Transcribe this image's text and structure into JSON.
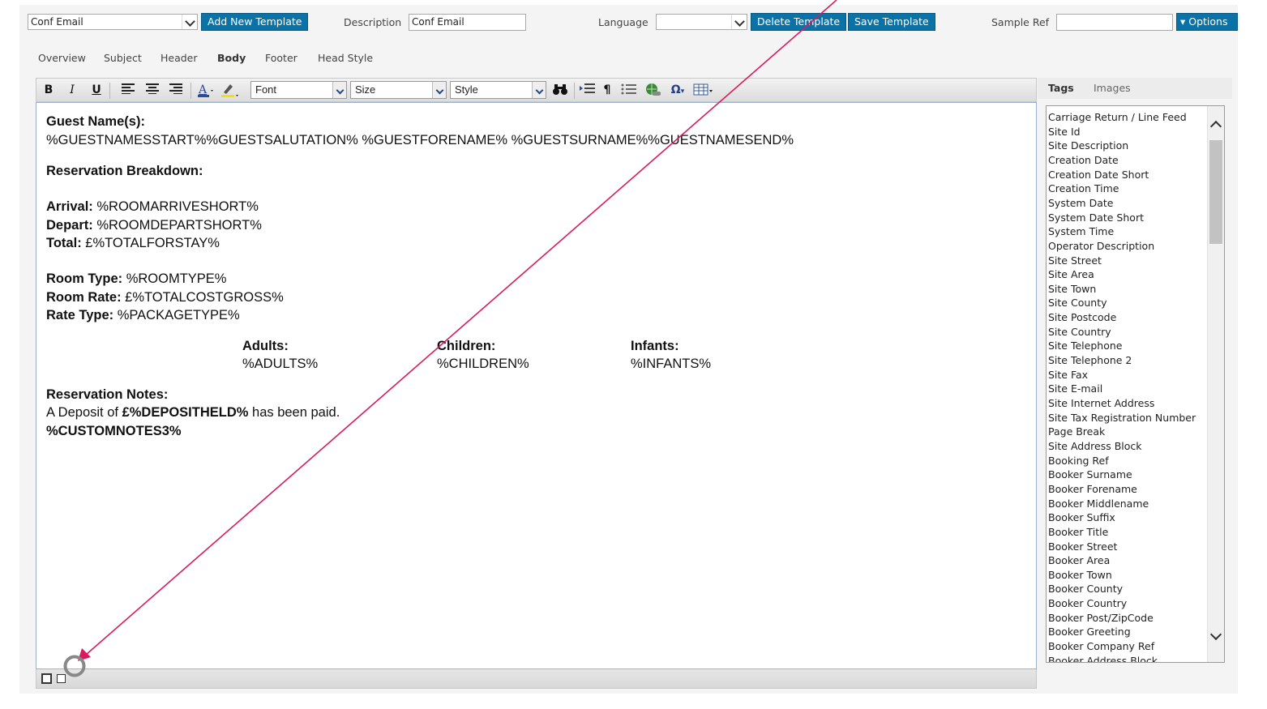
{
  "topbar": {
    "template_select_value": "Conf Email",
    "add_template_label": "Add New Template",
    "description_label": "Description",
    "description_value": "Conf Email",
    "language_label": "Language",
    "language_value": "",
    "delete_template_label": "Delete Template",
    "save_template_label": "Save Template",
    "sample_ref_label": "Sample Ref",
    "sample_ref_value": "",
    "options_label": "▾ Options"
  },
  "tabs": [
    "Overview",
    "Subject",
    "Header",
    "Body",
    "Footer",
    "Head Style"
  ],
  "active_tab": "Body",
  "toolbar": {
    "bold": "B",
    "italic": "I",
    "underline": "U",
    "font_label": "Font",
    "size_label": "Size",
    "style_label": "Style"
  },
  "editor": {
    "guest_heading": "Guest Name(s):",
    "guest_line": "%GUESTNAMESSTART%%GUESTSALUTATION% %GUESTFORENAME% %GUESTSURNAME%%GUESTNAMESEND%",
    "breakdown_heading": "Reservation Breakdown:",
    "arrival_label": "Arrival:",
    "arrival_value": " %ROOMARRIVESHORT%",
    "depart_label": "Depart:",
    "depart_value": " %ROOMDEPARTSHORT%",
    "total_label": "Total:",
    "total_value": " £%TOTALFORSTAY%",
    "room_type_label": "Room Type:",
    "room_type_value": " %ROOMTYPE%",
    "room_rate_label": "Room Rate:",
    "room_rate_value": " £%TOTALCOSTGROSS%",
    "rate_type_label": "Rate Type:",
    "rate_type_value": " %PACKAGETYPE%",
    "adults_label": "Adults:",
    "adults_value": "%ADULTS%",
    "children_label": "Children:",
    "children_value": "%CHILDREN%",
    "infants_label": "Infants:",
    "infants_value": "%INFANTS%",
    "notes_heading": "Reservation Notes:",
    "deposit_prefix": "A Deposit of ",
    "deposit_value": "£%DEPOSITHELD%",
    "deposit_suffix": " has been paid.",
    "custom_notes": "%CUSTOMNOTES3%"
  },
  "side": {
    "tags_tab": "Tags",
    "images_tab": "Images",
    "tags": [
      "Carriage Return / Line Feed",
      "Site Id",
      "Site Description",
      "Creation Date",
      "Creation Date Short",
      "Creation Time",
      "System Date",
      "System Date Short",
      "System Time",
      "Operator Description",
      "Site Street",
      "Site Area",
      "Site Town",
      "Site County",
      "Site Postcode",
      "Site Country",
      "Site Telephone",
      "Site Telephone 2",
      "Site Fax",
      "Site E-mail",
      "Site Internet Address",
      "Site Tax Registration Number",
      "Page Break",
      "Site Address Block",
      "Booking Ref",
      "Booker Surname",
      "Booker Forename",
      "Booker Middlename",
      "Booker Suffix",
      "Booker Title",
      "Booker Street",
      "Booker Area",
      "Booker Town",
      "Booker County",
      "Booker Country",
      "Booker Post/ZipCode",
      "Booker Greeting",
      "Booker Company Ref",
      "Booker Address Block"
    ]
  },
  "colors": {
    "button_blue": "#0b72a8",
    "annotation_pink": "#d81b60",
    "cursor_ring": "#888888"
  }
}
